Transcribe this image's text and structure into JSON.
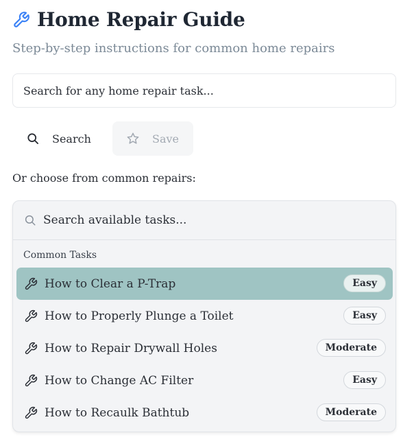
{
  "header": {
    "title": "Home Repair Guide",
    "subtitle": "Step-by-step instructions for common home repairs",
    "icon": "wrench-icon",
    "accent_color": "#3b82f6"
  },
  "main_search": {
    "placeholder": "Search for any home repair task..."
  },
  "actions": {
    "search_label": "Search",
    "save_label": "Save"
  },
  "choose_text": "Or choose from common repairs:",
  "task_panel": {
    "search_placeholder": "Search available tasks...",
    "group_label": "Common Tasks",
    "selected_color": "#9fc4c3",
    "tasks": [
      {
        "label": "How to Clear a P-Trap",
        "difficulty": "Easy",
        "selected": true
      },
      {
        "label": "How to Properly Plunge a Toilet",
        "difficulty": "Easy",
        "selected": false
      },
      {
        "label": "How to Repair Drywall Holes",
        "difficulty": "Moderate",
        "selected": false
      },
      {
        "label": "How to Change AC Filter",
        "difficulty": "Easy",
        "selected": false
      },
      {
        "label": "How to Recaulk Bathtub",
        "difficulty": "Moderate",
        "selected": false
      }
    ]
  }
}
